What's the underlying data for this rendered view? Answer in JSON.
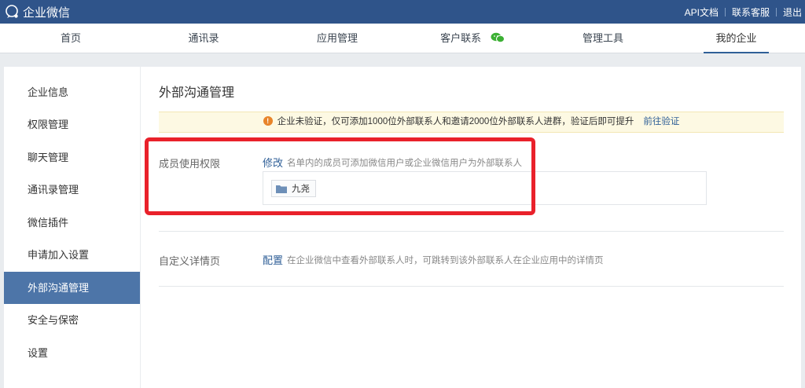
{
  "app": {
    "title": "企业微信"
  },
  "header_links": [
    {
      "label": "API文档"
    },
    {
      "label": "联系客服"
    },
    {
      "label": "退出"
    }
  ],
  "nav": {
    "items": [
      {
        "label": "首页"
      },
      {
        "label": "通讯录"
      },
      {
        "label": "应用管理"
      },
      {
        "label": "客户联系"
      },
      {
        "label": "管理工具"
      },
      {
        "label": "我的企业"
      }
    ],
    "active": "我的企业"
  },
  "sidebar": {
    "items": [
      {
        "label": "企业信息"
      },
      {
        "label": "权限管理"
      },
      {
        "label": "聊天管理"
      },
      {
        "label": "通讯录管理"
      },
      {
        "label": "微信插件"
      },
      {
        "label": "申请加入设置"
      },
      {
        "label": "外部沟通管理"
      },
      {
        "label": "安全与保密"
      },
      {
        "label": "设置"
      }
    ],
    "active": "外部沟通管理"
  },
  "main": {
    "title": "外部沟通管理",
    "notice": {
      "text": "企业未验证，仅可添加1000位外部联系人和邀请2000位外部联系人进群，验证后即可提升",
      "link": "前往验证"
    },
    "member_permission": {
      "label": "成员使用权限",
      "action": "修改",
      "description": "名单内的成员可添加微信用户或企业微信用户为外部联系人",
      "members": [
        {
          "name": "九尧"
        }
      ]
    },
    "custom_detail": {
      "label": "自定义详情页",
      "action": "配置",
      "description": "在企业微信中查看外部联系人时，可跳转到该外部联系人在企业应用中的详情页"
    }
  },
  "colors": {
    "header_bg": "#2f548a",
    "accent": "#2f5f97",
    "sidebar_active": "#4d75a8",
    "notice_bg": "#fdf9e3",
    "warning": "#e8842a",
    "highlight": "#e9212b",
    "wechat_green": "#3cb034"
  }
}
